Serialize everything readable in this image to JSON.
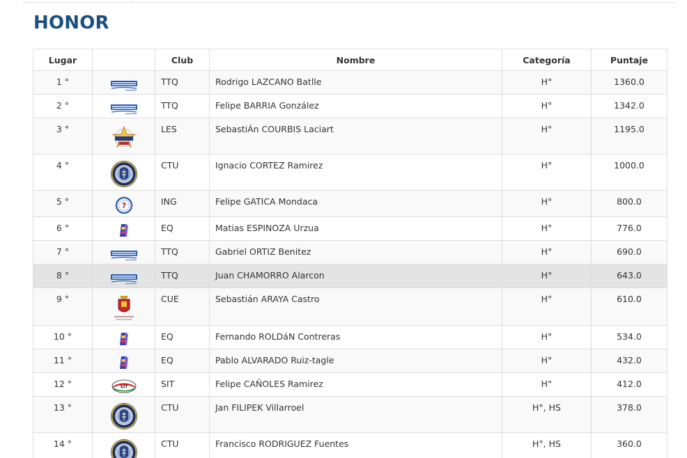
{
  "title": "HONOR",
  "columns": {
    "pos": "Lugar",
    "logo": "",
    "club": "Club",
    "name": "Nombre",
    "category": "Categoría",
    "points": "Puntaje"
  },
  "rows": [
    {
      "pos": "1 °",
      "logo": "tour-tenis-logo",
      "club": "TTQ",
      "name": "Rodrigo LAZCANO Batlle",
      "category": "H°",
      "points": "1360.0"
    },
    {
      "pos": "2 °",
      "logo": "tour-tenis-logo",
      "club": "TTQ",
      "name": "Felipe BARRIA González",
      "category": "H°",
      "points": "1342.0"
    },
    {
      "pos": "3 °",
      "logo": "star-badge-logo",
      "club": "LES",
      "name": "SebastiÁn COURBIS Laciart",
      "category": "H°",
      "points": "1195.0"
    },
    {
      "pos": "4 °",
      "logo": "ctu-seal-logo",
      "club": "CTU",
      "name": "Ignacio CORTEZ Ramirez",
      "category": "H°",
      "points": "1000.0"
    },
    {
      "pos": "5 °",
      "logo": "question-circle-logo",
      "club": "ING",
      "name": "Felipe GATICA Mondaca",
      "category": "H°",
      "points": "800.0"
    },
    {
      "pos": "6 °",
      "logo": "eq-flag-logo",
      "club": "EQ",
      "name": "Matias ESPINOZA Urzua",
      "category": "H°",
      "points": "776.0"
    },
    {
      "pos": "7 °",
      "logo": "tour-tenis-logo",
      "club": "TTQ",
      "name": "Gabriel ORTIZ Benitez",
      "category": "H°",
      "points": "690.0"
    },
    {
      "pos": "8 °",
      "logo": "tour-tenis-logo",
      "club": "TTQ",
      "name": "Juan CHAMORRO Alarcon",
      "category": "H°",
      "points": "643.0"
    },
    {
      "pos": "9 °",
      "logo": "cue-crest-logo",
      "club": "CUE",
      "name": "Sebastián ARAYA Castro",
      "category": "H°",
      "points": "610.0"
    },
    {
      "pos": "10 °",
      "logo": "eq-flag-logo",
      "club": "EQ",
      "name": "Fernando ROLDáN Contreras",
      "category": "H°",
      "points": "534.0"
    },
    {
      "pos": "11 °",
      "logo": "eq-flag-logo",
      "club": "EQ",
      "name": "Pablo ALVARADO Ruiz-tagle",
      "category": "H°",
      "points": "432.0"
    },
    {
      "pos": "12 °",
      "logo": "sit-oval-logo",
      "club": "SIT",
      "name": "Felipe CAÑOLES Ramirez",
      "category": "H°",
      "points": "412.0"
    },
    {
      "pos": "13 °",
      "logo": "ctu-seal-logo",
      "club": "CTU",
      "name": "Jan FILIPEK Villarroel",
      "category": "H°, HS",
      "points": "378.0"
    },
    {
      "pos": "14 °",
      "logo": "ctu-seal-logo",
      "club": "CTU",
      "name": "Francisco RODRIGUEZ Fuentes",
      "category": "H°, HS",
      "points": "360.0"
    },
    {
      "pos": "",
      "logo": "",
      "club": "",
      "name": "",
      "category": "",
      "points": ""
    }
  ],
  "highlighted_row": 8,
  "colors": {
    "title": "#1b4f7f",
    "border": "#dddddd",
    "stripe": "#f9f9f9",
    "highlight": "#e4e4e4"
  }
}
